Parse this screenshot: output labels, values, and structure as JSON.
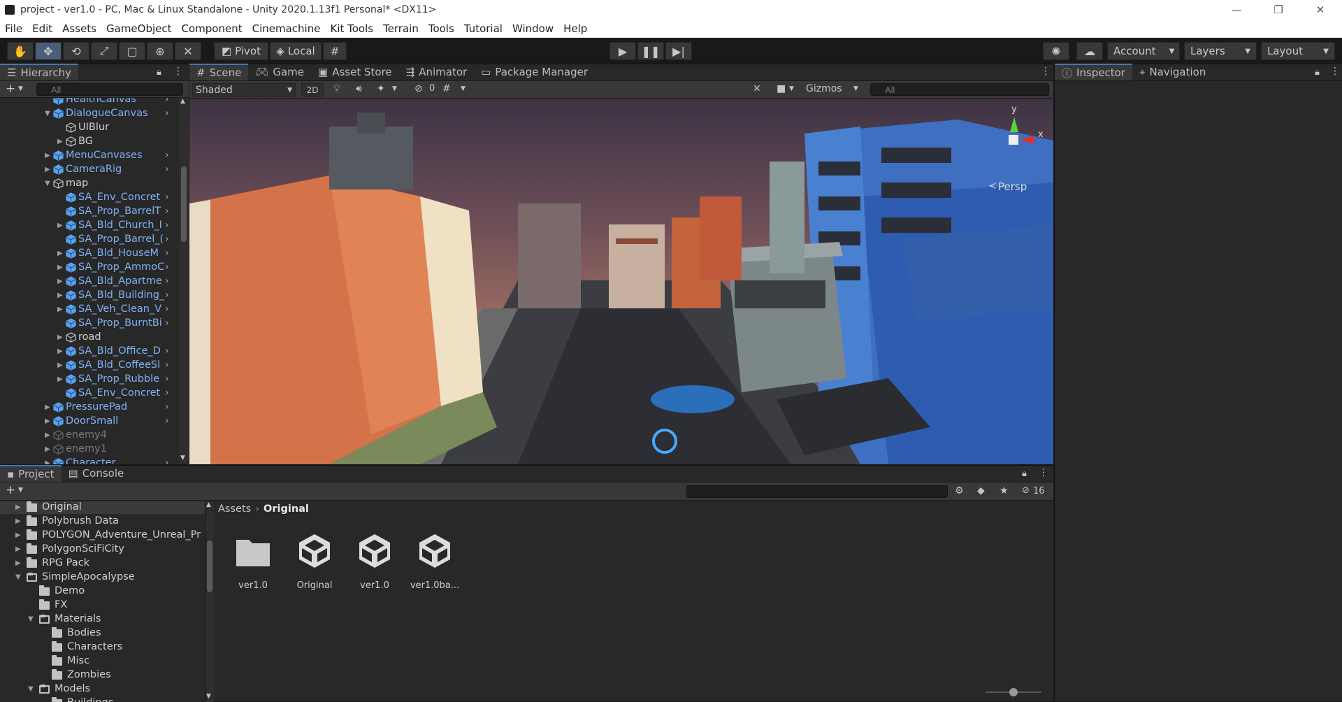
{
  "window": {
    "title": "project - ver1.0 - PC, Mac & Linux Standalone - Unity 2020.1.13f1 Personal* <DX11>",
    "minimize": "—",
    "restore": "❐",
    "close": "✕"
  },
  "menu": [
    "File",
    "Edit",
    "Assets",
    "GameObject",
    "Component",
    "Cinemachine",
    "Kit Tools",
    "Terrain",
    "Tools",
    "Tutorial",
    "Window",
    "Help"
  ],
  "toolbar": {
    "pivot": "Pivot",
    "local": "Local",
    "account": "Account",
    "layers": "Layers",
    "layout": "Layout"
  },
  "hierarchy": {
    "tab": "Hierarchy",
    "search_placeholder": "All",
    "items": [
      {
        "label": "HealthCanvas",
        "indent": 1,
        "tri": "",
        "kind": "prefab",
        "arrow": true
      },
      {
        "label": "DialogueCanvas",
        "indent": 1,
        "tri": "down",
        "kind": "prefab",
        "arrow": true
      },
      {
        "label": "UIBlur",
        "indent": 2,
        "tri": "",
        "kind": "object",
        "arrow": false
      },
      {
        "label": "BG",
        "indent": 2,
        "tri": "right",
        "kind": "object",
        "arrow": false
      },
      {
        "label": "MenuCanvases",
        "indent": 1,
        "tri": "right",
        "kind": "prefab",
        "arrow": true
      },
      {
        "label": "CameraRig",
        "indent": 1,
        "tri": "right",
        "kind": "prefab",
        "arrow": true
      },
      {
        "label": "map",
        "indent": 1,
        "tri": "down",
        "kind": "object",
        "arrow": false
      },
      {
        "label": "SA_Env_Concret",
        "indent": 2,
        "tri": "",
        "kind": "prefab",
        "arrow": true
      },
      {
        "label": "SA_Prop_BarrelT",
        "indent": 2,
        "tri": "",
        "kind": "prefab",
        "arrow": true
      },
      {
        "label": "SA_Bld_Church_I",
        "indent": 2,
        "tri": "right",
        "kind": "prefab",
        "arrow": true
      },
      {
        "label": "SA_Prop_Barrel_(",
        "indent": 2,
        "tri": "",
        "kind": "prefab",
        "arrow": true
      },
      {
        "label": "SA_Bld_HouseM",
        "indent": 2,
        "tri": "right",
        "kind": "prefab",
        "arrow": true
      },
      {
        "label": "SA_Prop_AmmoC",
        "indent": 2,
        "tri": "right",
        "kind": "prefab",
        "arrow": true
      },
      {
        "label": "SA_Bld_Apartme",
        "indent": 2,
        "tri": "right",
        "kind": "prefab",
        "arrow": true
      },
      {
        "label": "SA_Bld_Building_",
        "indent": 2,
        "tri": "right",
        "kind": "prefab",
        "arrow": true
      },
      {
        "label": "SA_Veh_Clean_V",
        "indent": 2,
        "tri": "right",
        "kind": "prefab",
        "arrow": true
      },
      {
        "label": "SA_Prop_BurntBi",
        "indent": 2,
        "tri": "",
        "kind": "prefab",
        "arrow": true
      },
      {
        "label": "road",
        "indent": 2,
        "tri": "right",
        "kind": "object",
        "arrow": false
      },
      {
        "label": "SA_Bld_Office_D",
        "indent": 2,
        "tri": "right",
        "kind": "prefab",
        "arrow": true
      },
      {
        "label": "SA_Bld_CoffeeSl",
        "indent": 2,
        "tri": "right",
        "kind": "prefab",
        "arrow": true
      },
      {
        "label": "SA_Prop_Rubble",
        "indent": 2,
        "tri": "right",
        "kind": "prefab",
        "arrow": true
      },
      {
        "label": "SA_Env_Concret",
        "indent": 2,
        "tri": "",
        "kind": "prefab",
        "arrow": true
      },
      {
        "label": "PressurePad",
        "indent": 1,
        "tri": "right",
        "kind": "prefab",
        "arrow": true
      },
      {
        "label": "DoorSmall",
        "indent": 1,
        "tri": "right",
        "kind": "prefab",
        "arrow": true
      },
      {
        "label": "enemy4",
        "indent": 1,
        "tri": "right",
        "kind": "disabled",
        "arrow": false
      },
      {
        "label": "enemy1",
        "indent": 1,
        "tri": "right",
        "kind": "disabled",
        "arrow": false
      },
      {
        "label": "Character",
        "indent": 1,
        "tri": "right",
        "kind": "prefab",
        "arrow": true
      }
    ]
  },
  "scene": {
    "tabs": [
      "Scene",
      "Game",
      "Asset Store",
      "Animator",
      "Package Manager"
    ],
    "shading": "Shaded",
    "mode_2d": "2D",
    "hidden_count": "0",
    "gizmos": "Gizmos",
    "search_placeholder": "All",
    "persp": "Persp",
    "axis_y": "y",
    "axis_x": "x"
  },
  "inspector": {
    "tabs": [
      "Inspector",
      "Navigation"
    ]
  },
  "project": {
    "tabs": [
      "Project",
      "Console"
    ],
    "hidden_count": "16",
    "breadcrumb": [
      "Assets",
      "Original"
    ],
    "tree": [
      {
        "label": "Original",
        "indent": 0,
        "tri": "right",
        "open": false,
        "selected": true
      },
      {
        "label": "Polybrush Data",
        "indent": 0,
        "tri": "right",
        "open": false
      },
      {
        "label": "POLYGON_Adventure_Unreal_Pr",
        "indent": 0,
        "tri": "right",
        "open": false
      },
      {
        "label": "PolygonSciFiCity",
        "indent": 0,
        "tri": "right",
        "open": false
      },
      {
        "label": "RPG Pack",
        "indent": 0,
        "tri": "right",
        "open": false
      },
      {
        "label": "SimpleApocalypse",
        "indent": 0,
        "tri": "down",
        "open": true
      },
      {
        "label": "Demo",
        "indent": 1,
        "tri": "",
        "open": false
      },
      {
        "label": "FX",
        "indent": 1,
        "tri": "",
        "open": false
      },
      {
        "label": "Materials",
        "indent": 1,
        "tri": "down",
        "open": true
      },
      {
        "label": "Bodies",
        "indent": 2,
        "tri": "",
        "open": false
      },
      {
        "label": "Characters",
        "indent": 2,
        "tri": "",
        "open": false
      },
      {
        "label": "Misc",
        "indent": 2,
        "tri": "",
        "open": false
      },
      {
        "label": "Zombies",
        "indent": 2,
        "tri": "",
        "open": false
      },
      {
        "label": "Models",
        "indent": 1,
        "tri": "down",
        "open": true
      },
      {
        "label": "Buildings",
        "indent": 2,
        "tri": "",
        "open": false
      }
    ],
    "assets": [
      {
        "label": "ver1.0",
        "kind": "folder"
      },
      {
        "label": "Original",
        "kind": "unity"
      },
      {
        "label": "ver1.0",
        "kind": "unity"
      },
      {
        "label": "ver1.0ba...",
        "kind": "unity"
      }
    ]
  }
}
